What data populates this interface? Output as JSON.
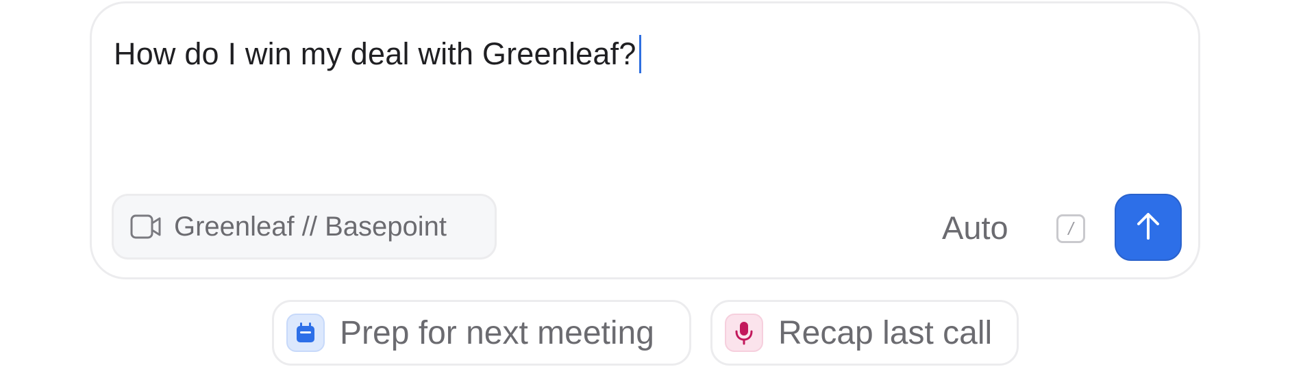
{
  "composer": {
    "prompt_text": "How do I win my deal with Greenleaf?",
    "context_chip": {
      "label": "Greenleaf // Basepoint",
      "icon": "video-camera-icon"
    },
    "mode_label": "Auto",
    "shortcut_key": "/",
    "send_button": {
      "icon": "arrow-up-icon",
      "color": "#2d6fe8"
    }
  },
  "suggestions": [
    {
      "label": "Prep for next meeting",
      "icon": "calendar-icon",
      "accent": "#2d6fe8"
    },
    {
      "label": "Recap last call",
      "icon": "microphone-icon",
      "accent": "#c2185b"
    }
  ]
}
